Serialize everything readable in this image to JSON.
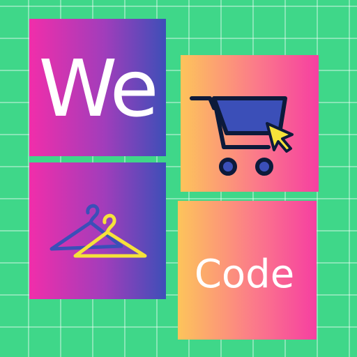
{
  "logo": {
    "word_top": "We",
    "word_bottom": "Code"
  },
  "icons": {
    "cart": "shopping-cart-icon",
    "cursor": "cursor-arrow-icon",
    "hangers": "clothes-hanger-icon"
  },
  "colors": {
    "background": "#3fd789",
    "magenta": "#f12eaa",
    "indigo": "#3d4fb8",
    "orange": "#fdc45b",
    "pink": "#f63fa1",
    "cart_fill": "#3b4fb8",
    "outline": "#0d1a3a",
    "yellow": "#f5e23a"
  }
}
